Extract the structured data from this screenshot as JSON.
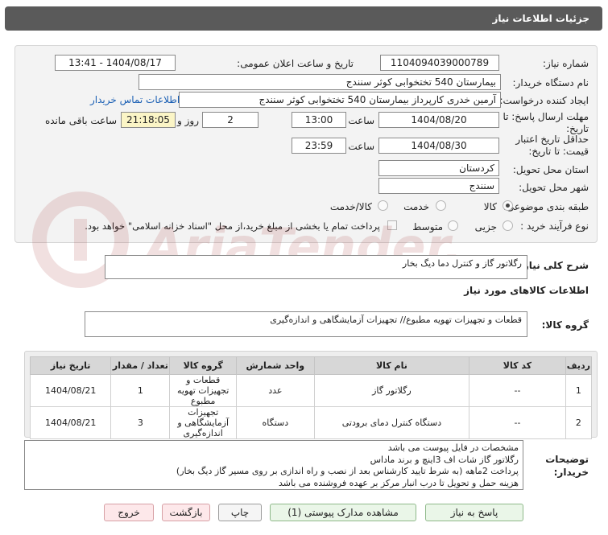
{
  "header": {
    "title": "جزئیات اطلاعات نیاز"
  },
  "form": {
    "need_number": {
      "label": "شماره نیاز:",
      "value": "1104094039000789"
    },
    "announce_datetime": {
      "label": "تاریخ و ساعت اعلان عمومی:",
      "value": "1404/08/17 - 13:41"
    },
    "buyer_org": {
      "label": "نام دستگاه خریدار:",
      "value": "بیمارستان 540 تختخوابی کوثر سنندج"
    },
    "requester": {
      "label": "ایجاد کننده درخواست:",
      "value": "آرمین خدری کارپرداز بیمارستان 540 تختخوابی کوثر سنندج",
      "contact_link": "اطلاعات تماس خریدار"
    },
    "reply_deadline": {
      "label": "مهلت ارسال پاسخ: تا تاریخ:",
      "date": "1404/08/20",
      "time_label": "ساعت",
      "time": "13:00",
      "days": "2",
      "days_label": "روز و",
      "remaining": "21:18:05",
      "remaining_label": "ساعت باقی مانده"
    },
    "price_validity": {
      "label": "حداقل تاریخ اعتبار قیمت: تا تاریخ:",
      "date": "1404/08/30",
      "time_label": "ساعت",
      "time": "23:59"
    },
    "province": {
      "label": "استان محل تحویل:",
      "value": "کردستان"
    },
    "city": {
      "label": "شهر محل تحویل:",
      "value": "سنندج"
    },
    "category": {
      "label": "طبقه بندی موضوعی:",
      "options": [
        "کالا",
        "خدمت",
        "کالا/خدمت"
      ],
      "selected": "کالا"
    },
    "process": {
      "label": "نوع فرآیند خرید :",
      "options": [
        "جزیی",
        "متوسط"
      ],
      "payment_note": "پرداخت تمام یا بخشی از مبلغ خرید،از محل \"اسناد خزانه اسلامی\" خواهد بود."
    }
  },
  "need_summary": {
    "label": "شرح کلی نیاز:",
    "value": "رگلاتور گاز و کنترل دما دیگ بخار"
  },
  "goods_section": {
    "title": "اطلاعات کالاهای مورد نیاز"
  },
  "goods_group": {
    "label": "گروه کالا:",
    "value": "قطعات و تجهیزات تهویه مطبوع// تجهیزات آزمایشگاهی و اندازه‌گیری"
  },
  "table": {
    "headers": [
      "ردیف",
      "کد کالا",
      "نام کالا",
      "واحد شمارش",
      "تعداد / مقدار",
      "تاریخ نیاز"
    ],
    "rows": [
      [
        "1",
        "--",
        "رگلاتور گاز",
        "عدد",
        "1",
        "قطعات و تجهیزات تهویه مطبوع",
        "1404/08/21"
      ],
      [
        "2",
        "--",
        "دستگاه کنترل دمای برودتی",
        "دستگاه",
        "3",
        "تجهیزات آزمایشگاهی و اندازه‌گیری",
        "1404/08/21"
      ]
    ],
    "group_header": "گروه کالا"
  },
  "buyer_notes": {
    "label": "توضیحات خریدار:",
    "lines": [
      "مشخصات در فایل پیوست می باشد",
      "رگلاتور گاز شات اف 3اینچ و برند ماداس",
      "پرداخت 2ماهه (به شرط تایید کارشناس بعد از نصب  و راه اندازی بر روی مسیر گاز دیگ بخار)",
      "هزینه حمل و تحویل تا درب انبار مرکز بر عهده فروشنده می باشد"
    ]
  },
  "buttons": {
    "reply": "پاسخ به نیاز",
    "attachments": "مشاهده مدارک پیوستی (1)",
    "print": "چاپ",
    "back": "بازگشت",
    "exit": "خروج"
  },
  "watermark": {
    "text": "AriaTender.net"
  }
}
